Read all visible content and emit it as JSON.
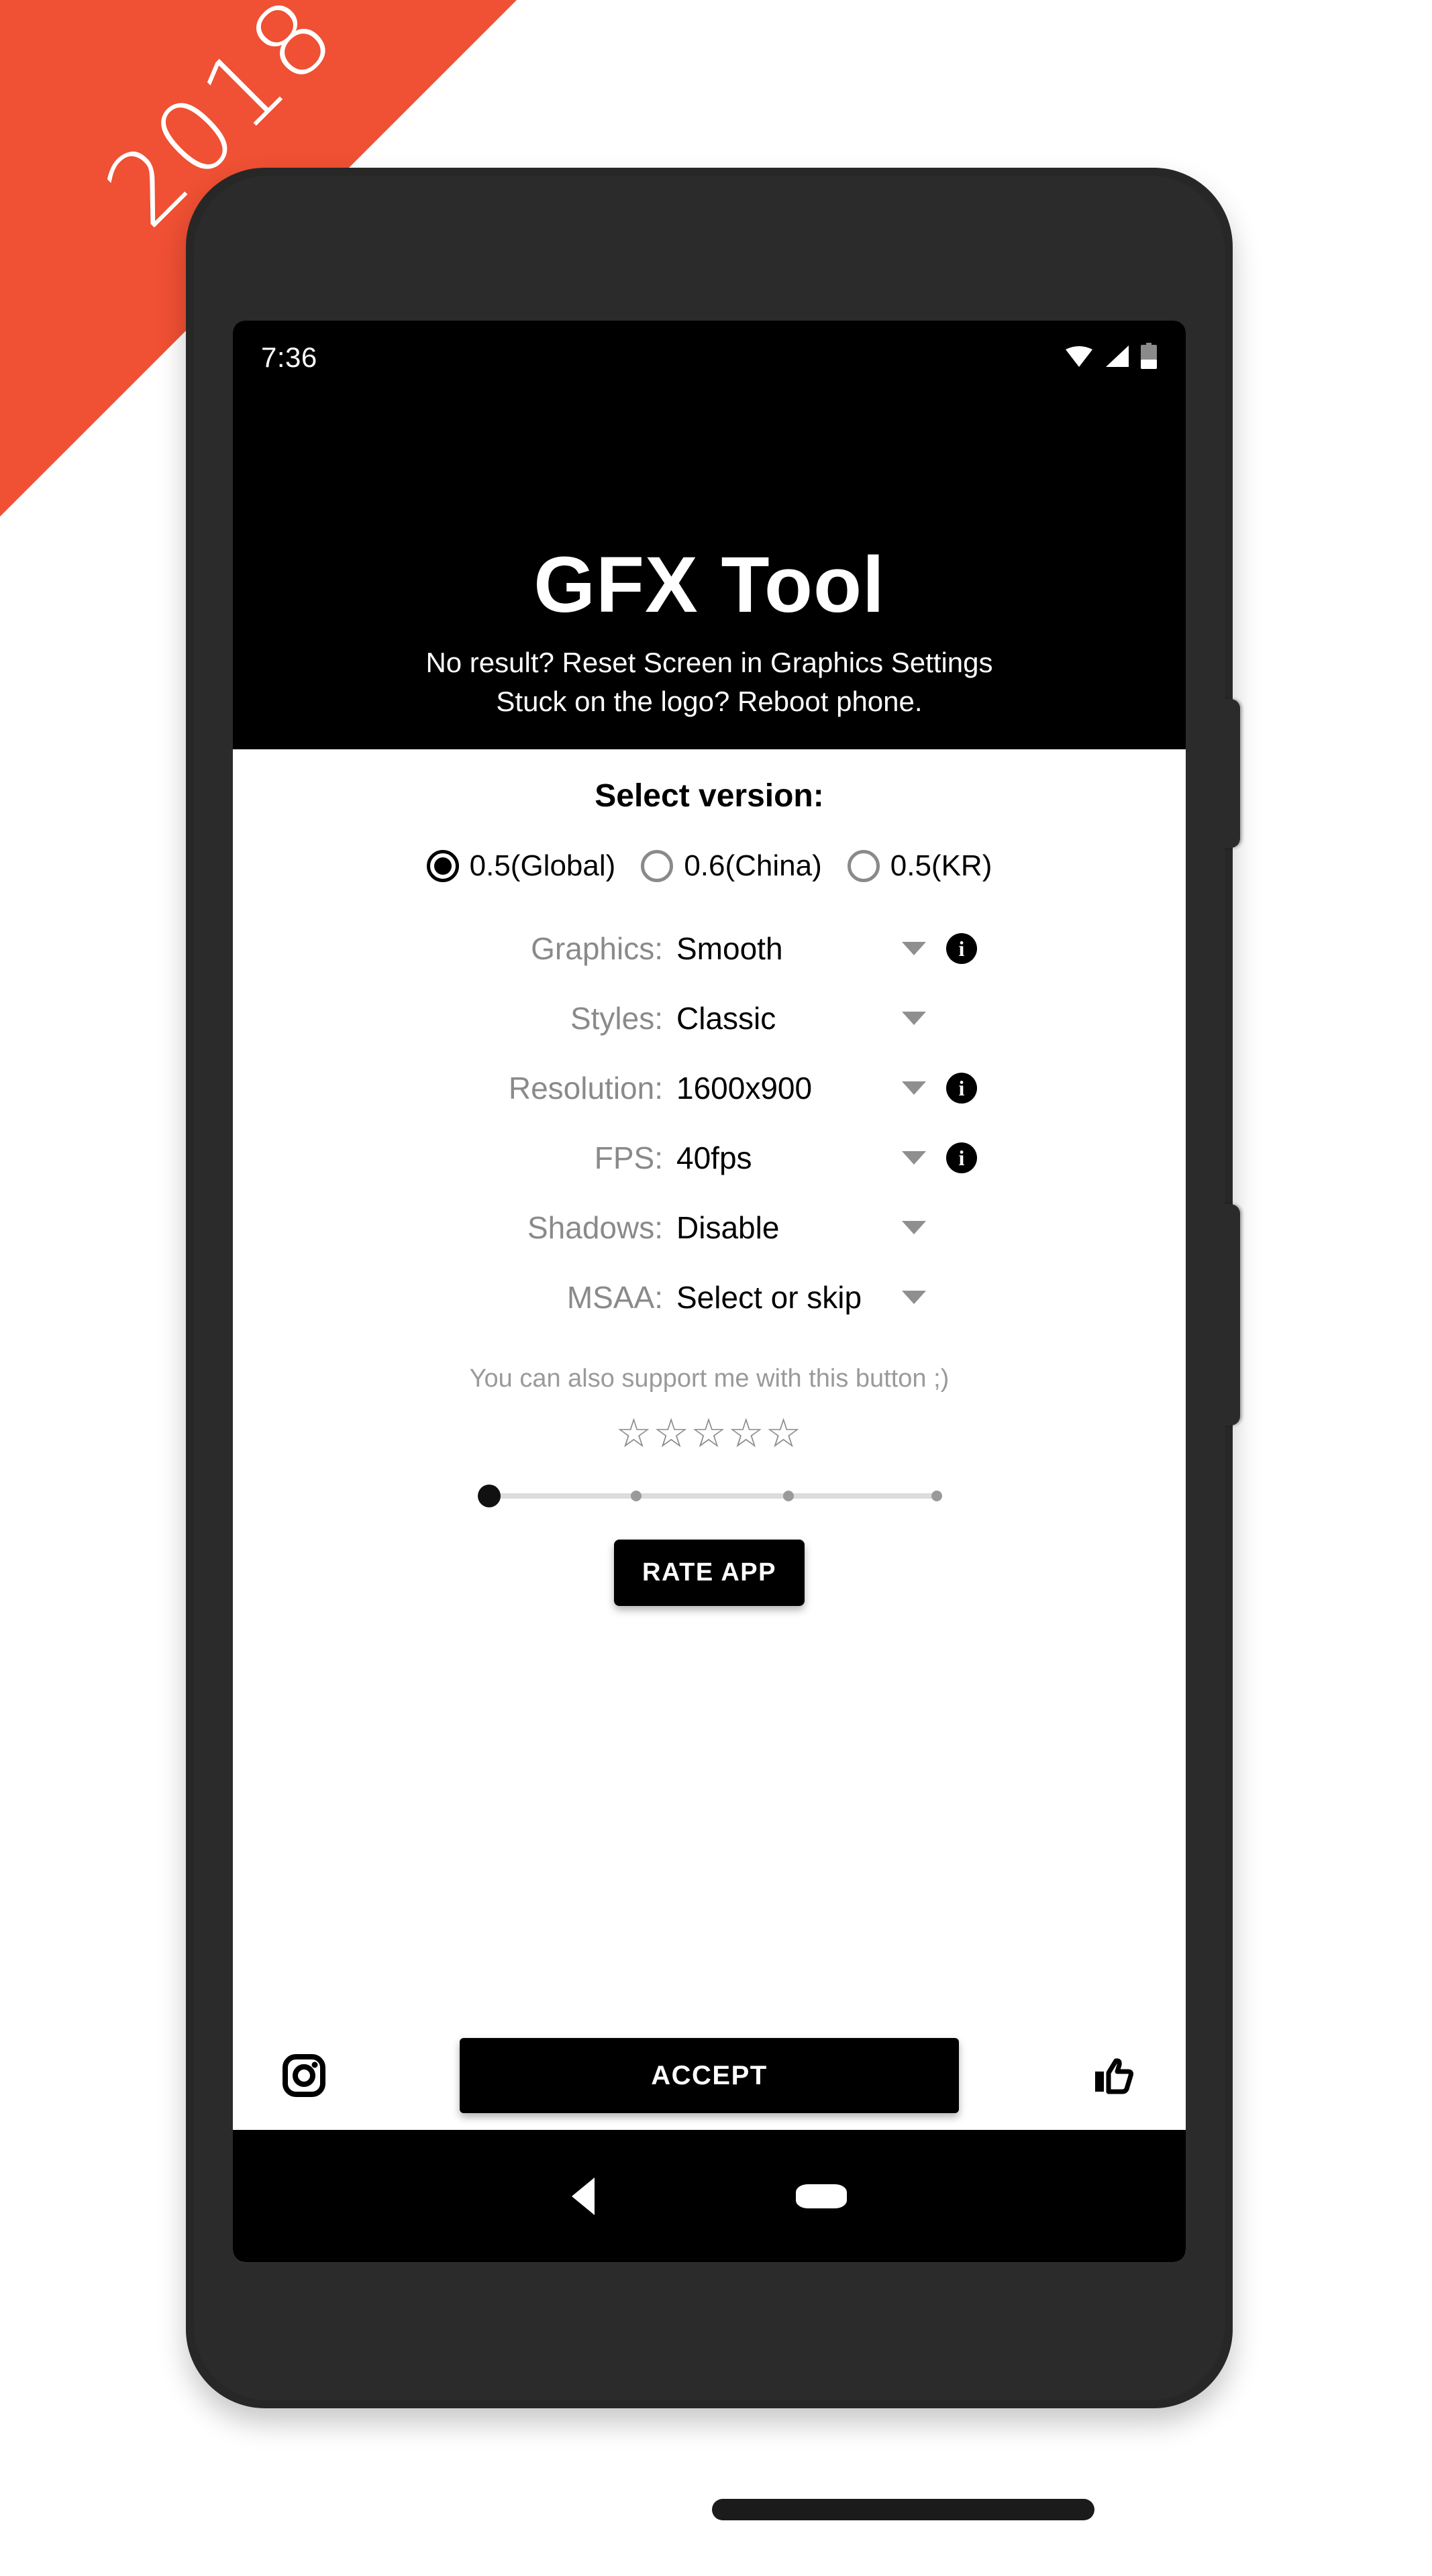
{
  "ribbon": {
    "label": "2018",
    "color": "#f05033"
  },
  "statusbar": {
    "time": "7:36",
    "icons": [
      "wifi-icon",
      "signal-icon",
      "battery-icon"
    ]
  },
  "header": {
    "title": "GFX Tool",
    "subtitle_line1": "No result? Reset Screen in Graphics Settings",
    "subtitle_line2": "Stuck on the logo? Reboot phone."
  },
  "version_section": {
    "title": "Select version:",
    "options": [
      {
        "label": "0.5(Global)",
        "selected": true
      },
      {
        "label": "0.6(China)",
        "selected": false
      },
      {
        "label": "0.5(KR)",
        "selected": false
      }
    ]
  },
  "settings": [
    {
      "label": "Graphics:",
      "value": "Smooth",
      "has_info": true
    },
    {
      "label": "Styles:",
      "value": "Classic",
      "has_info": false
    },
    {
      "label": "Resolution:",
      "value": "1600x900",
      "has_info": true
    },
    {
      "label": "FPS:",
      "value": "40fps",
      "has_info": true
    },
    {
      "label": "Shadows:",
      "value": "Disable",
      "has_info": false
    },
    {
      "label": "MSAA:",
      "value": "Select or skip",
      "has_info": false
    }
  ],
  "support": {
    "text": "You can also support me with this button ;)",
    "stars": "☆☆☆☆☆",
    "star_count": 5,
    "rated": 0,
    "slider_value": 0,
    "slider_ticks": 4,
    "rate_button": "RATE APP"
  },
  "bottom_bar": {
    "instagram_icon": "instagram-icon",
    "accept_button": "ACCEPT",
    "thumbs_up_icon": "thumbs-up-icon"
  },
  "navbar": {
    "back_icon": "back-triangle-icon",
    "home_icon": "home-pill-icon"
  },
  "colors": {
    "ribbon": "#f05033",
    "header_bg": "#000000",
    "body_bg": "#ffffff",
    "label_gray": "#8a8a8a",
    "value_black": "#000000",
    "phone_frame": "#272727"
  }
}
